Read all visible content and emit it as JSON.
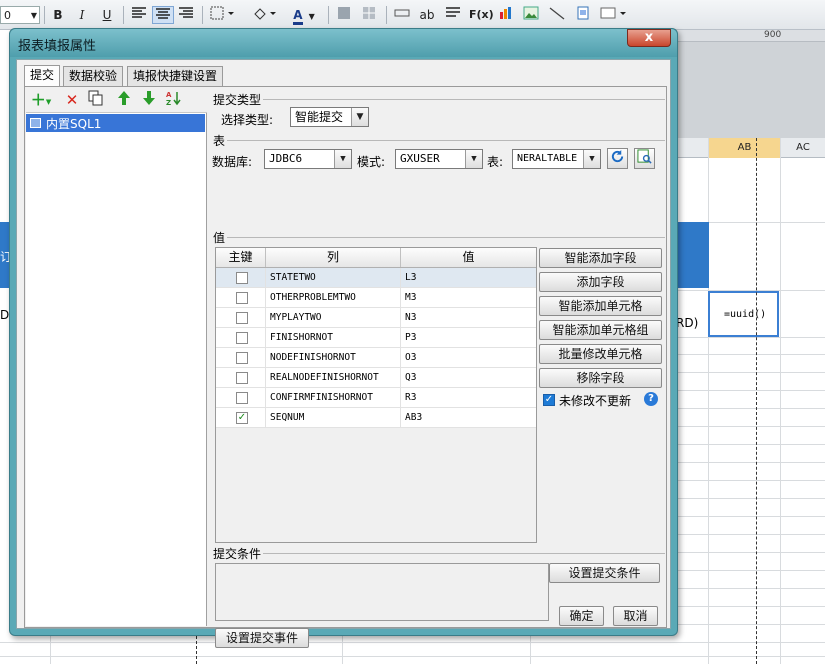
{
  "toolbar": {
    "zoom_value": "0",
    "bold": "B",
    "italic": "I",
    "underline": "U",
    "font_color": "A",
    "text_ab": "ab",
    "formula": "F(x)"
  },
  "ruler": {
    "label": "900"
  },
  "sheet": {
    "columns": [
      "AB",
      "AC"
    ],
    "left_blue_text": "订",
    "left_d": "D",
    "rd_text": "RD)",
    "uuid_cell": "=uuid()"
  },
  "dialog": {
    "title": "报表填报属性",
    "close": "x",
    "tabs": [
      "提交",
      "数据校验",
      "填报快捷键设置"
    ],
    "left_panel": {
      "tools": [
        "add-icon",
        "delete-icon",
        "copy-icon",
        "move-up-icon",
        "move-down-icon",
        "sort-icon"
      ],
      "items": [
        "内置SQL1"
      ]
    },
    "submit_type": {
      "group_title": "提交类型",
      "label": "选择类型:",
      "value": "智能提交"
    },
    "table": {
      "group_title": "表",
      "db_label": "数据库:",
      "db_value": "JDBC6",
      "schema_label": "模式:",
      "schema_value": "GXUSER",
      "table_label": "表:",
      "table_value": "NERALTABLE"
    },
    "values": {
      "group_title": "值",
      "headers": [
        "主键",
        "列",
        "值"
      ],
      "rows": [
        {
          "key": false,
          "column": "STATETWO",
          "value": "L3"
        },
        {
          "key": false,
          "column": "OTHERPROBLEMTWO",
          "value": "M3"
        },
        {
          "key": false,
          "column": "MYPLAYTWO",
          "value": "N3"
        },
        {
          "key": false,
          "column": "FINISHORNOT",
          "value": "P3"
        },
        {
          "key": false,
          "column": "NODEFINISHORNOT",
          "value": "O3"
        },
        {
          "key": false,
          "column": "REALNODEFINISHORNOT",
          "value": "Q3"
        },
        {
          "key": false,
          "column": "CONFIRMFINISHORNOT",
          "value": "R3"
        },
        {
          "key": true,
          "column": "SEQNUM",
          "value": "AB3"
        }
      ],
      "check_mark": "✓",
      "buttons": [
        "智能添加字段",
        "添加字段",
        "智能添加单元格",
        "智能添加单元格组",
        "批量修改单元格",
        "移除字段"
      ],
      "unmodified_label": "未修改不更新",
      "help": "?"
    },
    "condition": {
      "group_title": "提交条件",
      "set_button": "设置提交条件"
    },
    "event_button": "设置提交事件",
    "ok": "确定",
    "cancel": "取消"
  }
}
